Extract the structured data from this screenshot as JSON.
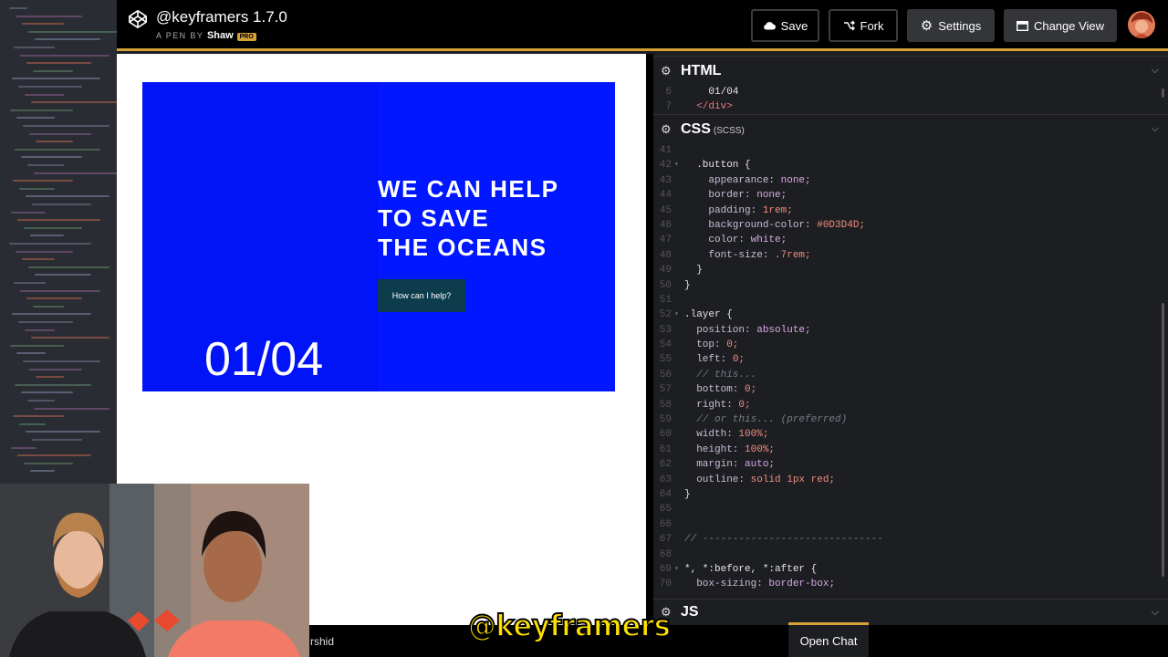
{
  "header": {
    "pen_title": "@keyframers 1.7.0",
    "pen_sub_prefix": "A PEN BY",
    "pen_author": "Shaw",
    "pro_badge": "PRO",
    "buttons": {
      "save": "Save",
      "fork": "Fork",
      "settings": "Settings",
      "change_view": "Change View"
    }
  },
  "preview": {
    "slide_counter": "01/04",
    "slide_title": [
      "WE CAN HELP",
      "TO SAVE",
      "THE OCEANS"
    ],
    "cta_label": "How can I help?"
  },
  "panes": {
    "html": {
      "title": "HTML",
      "lines": [
        {
          "n": "6",
          "text": "    01/04"
        },
        {
          "n": "7",
          "text": "  </div>"
        }
      ]
    },
    "css": {
      "title": "CSS",
      "subtitle": "(SCSS)",
      "lines": [
        {
          "n": "41",
          "text": ""
        },
        {
          "n": "42",
          "text": "  .button {",
          "fold": true
        },
        {
          "n": "43",
          "text": "    appearance: none;"
        },
        {
          "n": "44",
          "text": "    border: none;"
        },
        {
          "n": "45",
          "text": "    padding: 1rem;"
        },
        {
          "n": "46",
          "text": "    background-color: #0D3D4D;"
        },
        {
          "n": "47",
          "text": "    color: white;"
        },
        {
          "n": "48",
          "text": "    font-size: .7rem;"
        },
        {
          "n": "49",
          "text": "  }"
        },
        {
          "n": "50",
          "text": "}"
        },
        {
          "n": "51",
          "text": ""
        },
        {
          "n": "52",
          "text": ".layer {",
          "fold": true
        },
        {
          "n": "53",
          "text": "  position: absolute;"
        },
        {
          "n": "54",
          "text": "  top: 0;"
        },
        {
          "n": "55",
          "text": "  left: 0;"
        },
        {
          "n": "56",
          "text": "  // this..."
        },
        {
          "n": "57",
          "text": "  bottom: 0;"
        },
        {
          "n": "58",
          "text": "  right: 0;"
        },
        {
          "n": "59",
          "text": "  // or this... (preferred)"
        },
        {
          "n": "60",
          "text": "  width: 100%;"
        },
        {
          "n": "61",
          "text": "  height: 100%;"
        },
        {
          "n": "62",
          "text": "  margin: auto;"
        },
        {
          "n": "63",
          "text": "  outline: solid 1px red;"
        },
        {
          "n": "64",
          "text": "}"
        },
        {
          "n": "65",
          "text": ""
        },
        {
          "n": "66",
          "text": ""
        },
        {
          "n": "67",
          "text": "// ------------------------------"
        },
        {
          "n": "68",
          "text": ""
        },
        {
          "n": "69",
          "text": "*, *:before, *:after {",
          "fold": true
        },
        {
          "n": "70",
          "text": "  box-sizing: border-box;"
        }
      ]
    },
    "js": {
      "title": "JS"
    }
  },
  "chat": {
    "user": "rshid",
    "open_label": "Open Chat"
  },
  "watermark": "@keyframers",
  "colors": {
    "accent": "#d4a237",
    "slide_blue": "#0017ff",
    "cta_bg": "#0d3d4d",
    "code_property": "#c9bcd6",
    "code_value": "#d7a9e6",
    "code_number": "#f08d7e",
    "code_comment": "#777a85",
    "code_selector": "#e5e5e5",
    "watermark": "#ffe100"
  }
}
